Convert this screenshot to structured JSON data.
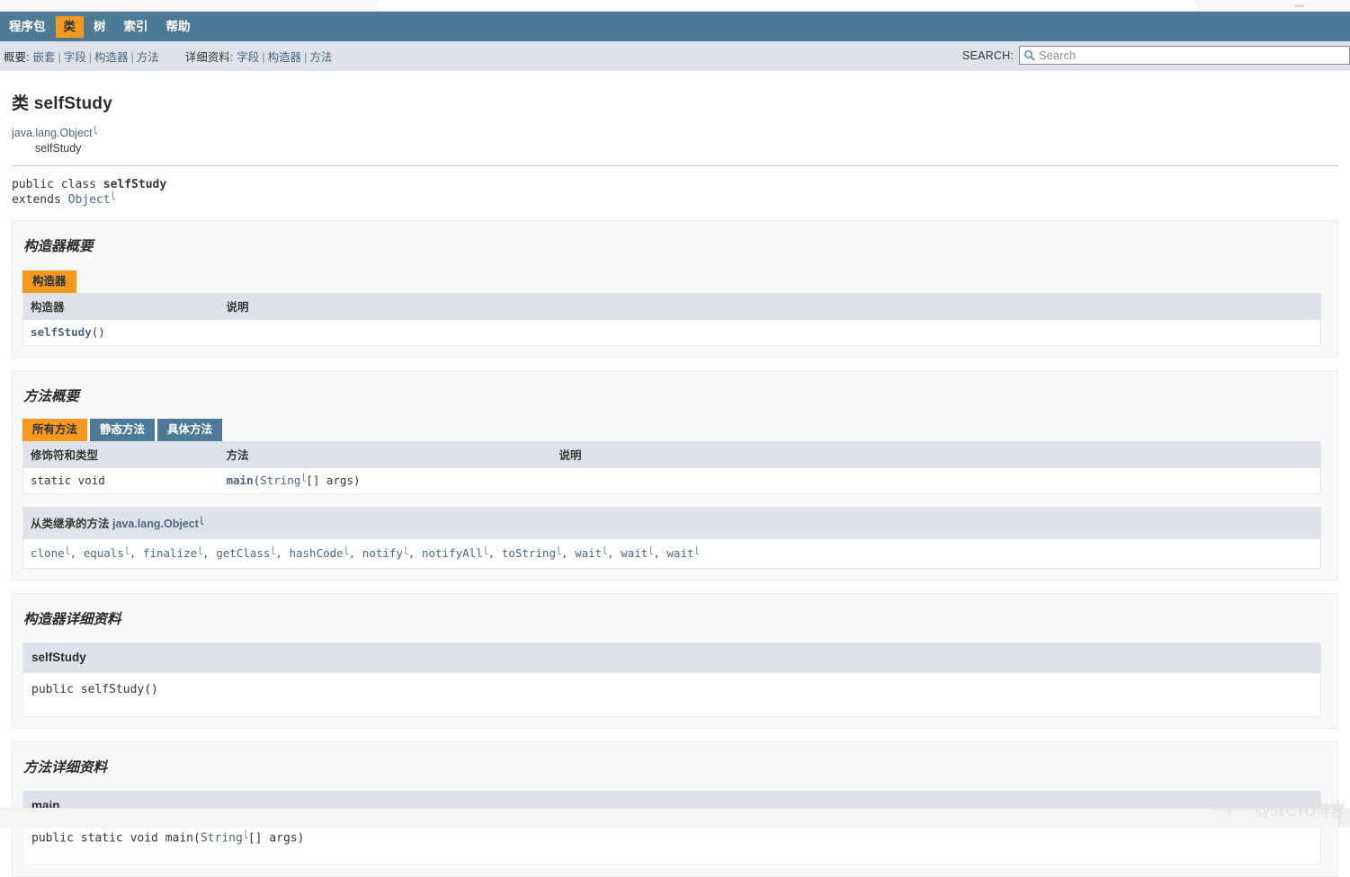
{
  "browser": {
    "tab_strip": "browser-tab-remnant"
  },
  "topnav": {
    "items": [
      {
        "label": "程序包",
        "active": false
      },
      {
        "label": "类",
        "active": true
      },
      {
        "label": "树",
        "active": false
      },
      {
        "label": "索引",
        "active": false
      },
      {
        "label": "帮助",
        "active": false
      }
    ]
  },
  "subnav": {
    "summary_label": "概要:",
    "summary_links": [
      "嵌套",
      "字段",
      "构造器",
      "方法"
    ],
    "detail_label": "详细资料:",
    "detail_links": [
      "字段",
      "构造器",
      "方法"
    ],
    "separator": "|"
  },
  "search": {
    "label": "SEARCH:",
    "placeholder": "Search",
    "value": "",
    "icon": "search-icon"
  },
  "header": {
    "class_kind": "类",
    "class_name": "selfStudy",
    "inheritance": {
      "parent": "java.lang.Object",
      "parent_external": true,
      "child": "selfStudy"
    },
    "signature": {
      "modifiers": "public class",
      "name": "selfStudy",
      "extends_keyword": "extends",
      "extends_type": "Object",
      "extends_external": true
    }
  },
  "constructor_summary": {
    "title": "构造器概要",
    "tabs": [
      {
        "label": "构造器",
        "active": true
      }
    ],
    "columns": [
      "构造器",
      "说明"
    ],
    "rows": [
      {
        "ctor_name": "selfStudy",
        "ctor_args": "()",
        "description": ""
      }
    ]
  },
  "method_summary": {
    "title": "方法概要",
    "tabs": [
      {
        "label": "所有方法",
        "active": true
      },
      {
        "label": "静态方法",
        "active": false
      },
      {
        "label": "具体方法",
        "active": false
      }
    ],
    "columns": [
      "修饰符和类型",
      "方法",
      "说明"
    ],
    "rows": [
      {
        "modifier_type": "static void",
        "method_name": "main",
        "method_open": "(",
        "method_param_type": "String",
        "method_param_ext": true,
        "method_param_rest": "[]  args)",
        "description": ""
      }
    ],
    "inherited": {
      "heading_prefix": "从类继承的方法",
      "heading_class": "java.lang.Object",
      "heading_class_external": true,
      "methods": [
        "clone",
        "equals",
        "finalize",
        "getClass",
        "hashCode",
        "notify",
        "notifyAll",
        "toString",
        "wait",
        "wait",
        "wait"
      ],
      "separator": ", "
    }
  },
  "constructor_detail": {
    "title": "构造器详细资料",
    "entries": [
      {
        "name": "selfStudy",
        "signature": "public  selfStudy()"
      }
    ]
  },
  "method_detail": {
    "title": "方法详细资料",
    "entries": [
      {
        "name": "main",
        "sig_prefix": "public static  void  main(",
        "sig_type": "String",
        "sig_type_external": true,
        "sig_suffix": "[]  args)"
      }
    ]
  },
  "watermark": {
    "url": "https://blog.csdn.net/",
    "site": "@51CTO博客"
  },
  "colors": {
    "nav_bg": "#4d7a97",
    "accent_orange": "#f8981d",
    "subnav_bg": "#dee3e9",
    "link": "#4a6782",
    "section_bg": "#f8f8f8",
    "text": "#353833"
  }
}
